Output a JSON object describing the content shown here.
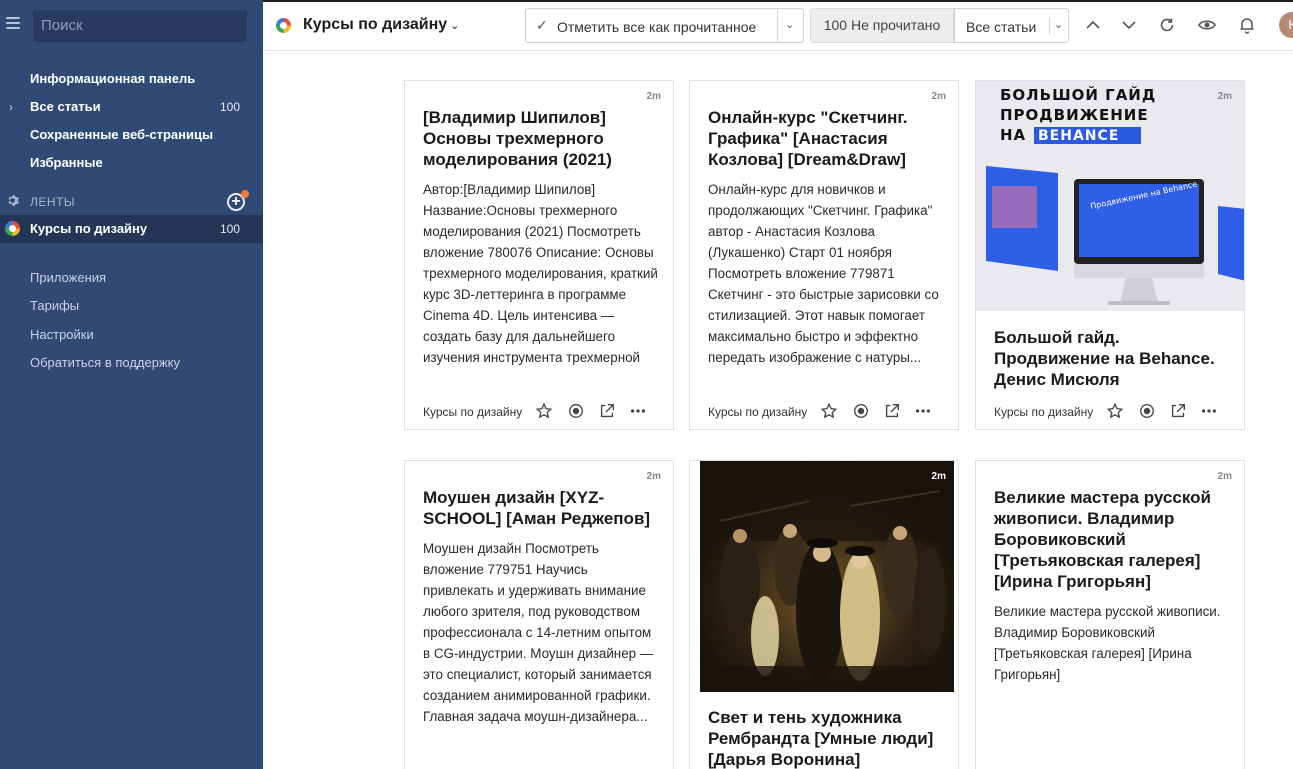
{
  "sidebar": {
    "search_placeholder": "Поиск",
    "nav": [
      {
        "label": "Информационная панель",
        "count": ""
      },
      {
        "label": "Все статьи",
        "count": "100"
      },
      {
        "label": "Сохраненные веб-страницы",
        "count": ""
      },
      {
        "label": "Избранные",
        "count": ""
      }
    ],
    "feeds_label": "ЛЕНТЫ",
    "active_feed": {
      "label": "Курсы по дизайну",
      "count": "100"
    },
    "sub_items": [
      "Приложения",
      "Тарифы",
      "Настройки",
      "Обратиться в поддержку"
    ]
  },
  "header": {
    "feed_title": "Курсы по дизайну",
    "mark_all_label": "Отметить все как прочитанное",
    "unread_label": "100 Не прочитано",
    "filter_label": "Все статьи",
    "avatar_initial": "К"
  },
  "cards": [
    {
      "age": "2m",
      "title": "[Владимир Шипилов] Основы трехмерного моделирования (2021)",
      "desc": "Автор:[Владимир Шипилов] Название:Основы трехмерного моделирования (2021) Посмотреть вложение 780076 Описание: Основы трехмерного моделирования, краткий курс 3D-леттеринга в программе Cinema 4D. Цель интенсива — создать базу для дальнейшего изучения инструмента трехмерной",
      "source": "Курсы по дизайну"
    },
    {
      "age": "2m",
      "title": "Онлайн-курс \"Скетчинг. Графика\" [Анастасия Козлова] [Dream&Draw]",
      "desc": "Онлайн-курс для новичков и продолжающих \"Скетчинг. Графика\" автор - Анастасия Козлова (Лукашенко) Старт 01 ноября Посмотреть вложение 779871 Скетчинг - это быстрые зарисовки со стилизацией. Этот навык помогает максимально быстро и эффектно передать изображение с натуры...",
      "source": "Курсы по дизайну"
    },
    {
      "age": "2m",
      "title": "Большой гайд. Продвижение на Behance. Денис Мисюля",
      "image_text_1": "БОЛЬШОЙ ГАЙД",
      "image_text_2": "ПРОДВИЖЕНИЕ",
      "image_text_3": "НА",
      "image_text_4": "BEHANCE",
      "image_screen_text": "Продвижение на Behance",
      "source": "Курсы по дизайну"
    },
    {
      "age": "2m",
      "title": "Моушен дизайн [XYZ-SCHOOL] [Аман Реджепов]",
      "desc": "Моушен дизайн Посмотреть вложение 779751 Научись привлекать и удерживать внимание любого зрителя, под руководством профессионала с 14-летним опытом в CG-индустрии. Моушн дизайнер — это специалист, который занимается созданием анимированной графики. Главная задача моушн-дизайнера..."
    },
    {
      "age": "2m",
      "title": "Свет и тень художника Рембрандта [Умные люди] [Дарья Воронина]"
    },
    {
      "age": "2m",
      "title": "Великие мастера русской живописи. Владимир Боровиковский [Третьяковская галерея] [Ирина Григорьян]",
      "desc": "Великие мастера русской живописи. Владимир Боровиковский [Третьяковская галерея] [Ирина Григорьян]"
    }
  ]
}
